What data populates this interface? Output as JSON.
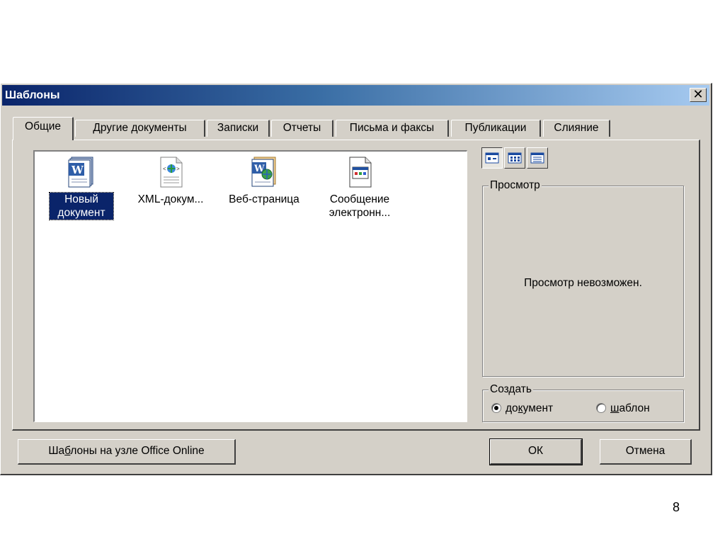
{
  "window": {
    "title": "Шаблоны",
    "close_label": "✕"
  },
  "tabs": [
    {
      "label": "Общие",
      "active": true
    },
    {
      "label": "Другие документы",
      "active": false
    },
    {
      "label": "Записки",
      "active": false
    },
    {
      "label": "Отчеты",
      "active": false
    },
    {
      "label": "Письма и факсы",
      "active": false
    },
    {
      "label": "Публикации",
      "active": false
    },
    {
      "label": "Слияние",
      "active": false
    }
  ],
  "templates": [
    {
      "label": "Новый документ",
      "icon": "word-document-icon",
      "selected": true
    },
    {
      "label": "XML-докум...",
      "icon": "xml-document-icon",
      "selected": false
    },
    {
      "label": "Веб-страница",
      "icon": "web-page-icon",
      "selected": false
    },
    {
      "label": "Сообщение электронн...",
      "icon": "email-message-icon",
      "selected": false
    }
  ],
  "view_buttons": [
    {
      "icon": "large-icons-view-icon",
      "pressed": true
    },
    {
      "icon": "list-view-icon",
      "pressed": false
    },
    {
      "icon": "details-view-icon",
      "pressed": false
    }
  ],
  "preview": {
    "legend": "Просмотр",
    "message": "Просмотр невозможен."
  },
  "create": {
    "legend": "Создать",
    "options": [
      {
        "label_pre": "до",
        "label_u": "к",
        "label_post": "умент",
        "checked": true
      },
      {
        "label_pre": "",
        "label_u": "ш",
        "label_post": "аблон",
        "checked": false
      }
    ]
  },
  "buttons": {
    "online_pre": "Ша",
    "online_u": "б",
    "online_post": "лоны на узле Office Online",
    "ok": "ОК",
    "cancel": "Отмена"
  },
  "colors": {
    "face": "#d4d0c8",
    "title_start": "#0a246a",
    "title_end": "#a6caf0",
    "selection": "#0a246a"
  },
  "page_number": "8"
}
